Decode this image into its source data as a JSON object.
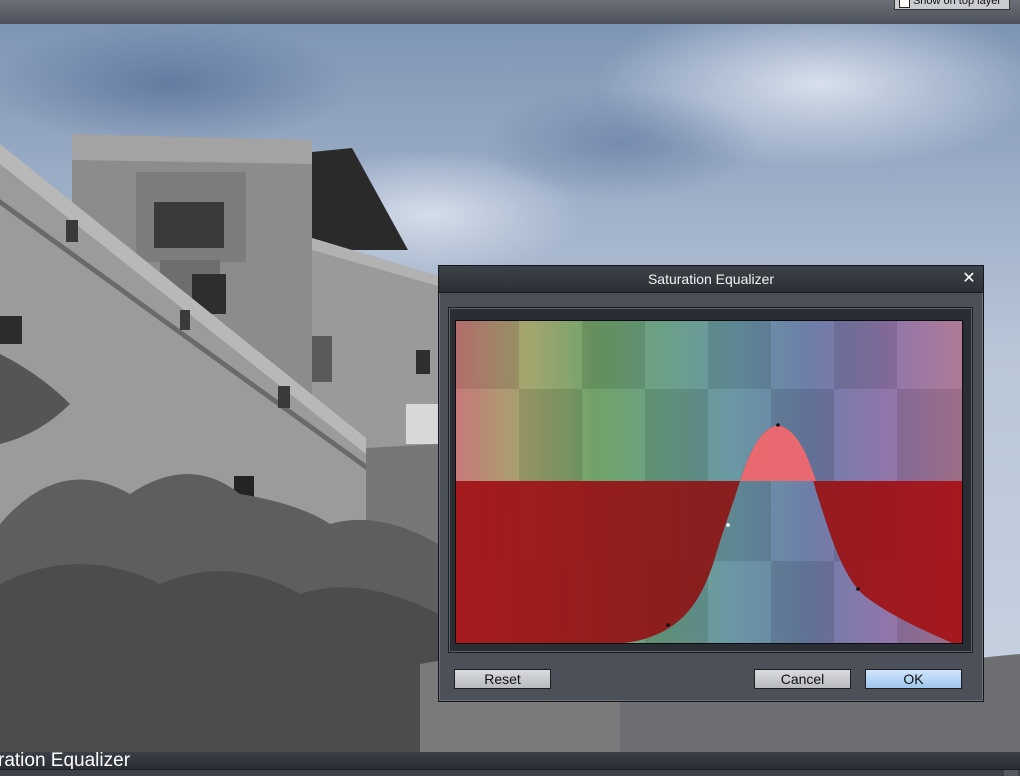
{
  "top_strip": {
    "checkbox_label": "Show on top layer"
  },
  "caption": {
    "title": "ration Equalizer"
  },
  "dialog": {
    "title": "Saturation Equalizer",
    "close_symbol": "✕",
    "reset_label": "Reset",
    "cancel_label": "Cancel",
    "ok_label": "OK"
  },
  "colors": {
    "curve_fill": "#b5141c",
    "peak_highlight": "#e86a70",
    "ok_accent": "#9fc7ee"
  },
  "equalizer": {
    "hue_bands": [
      "#c77a7a",
      "#a4a66e",
      "#6fa26a",
      "#6aa08a",
      "#6a96a6",
      "#6d7ea8",
      "#8d76ac",
      "#b07a96"
    ],
    "icons": [
      "close-icon",
      "curve-control-point-icon"
    ]
  }
}
